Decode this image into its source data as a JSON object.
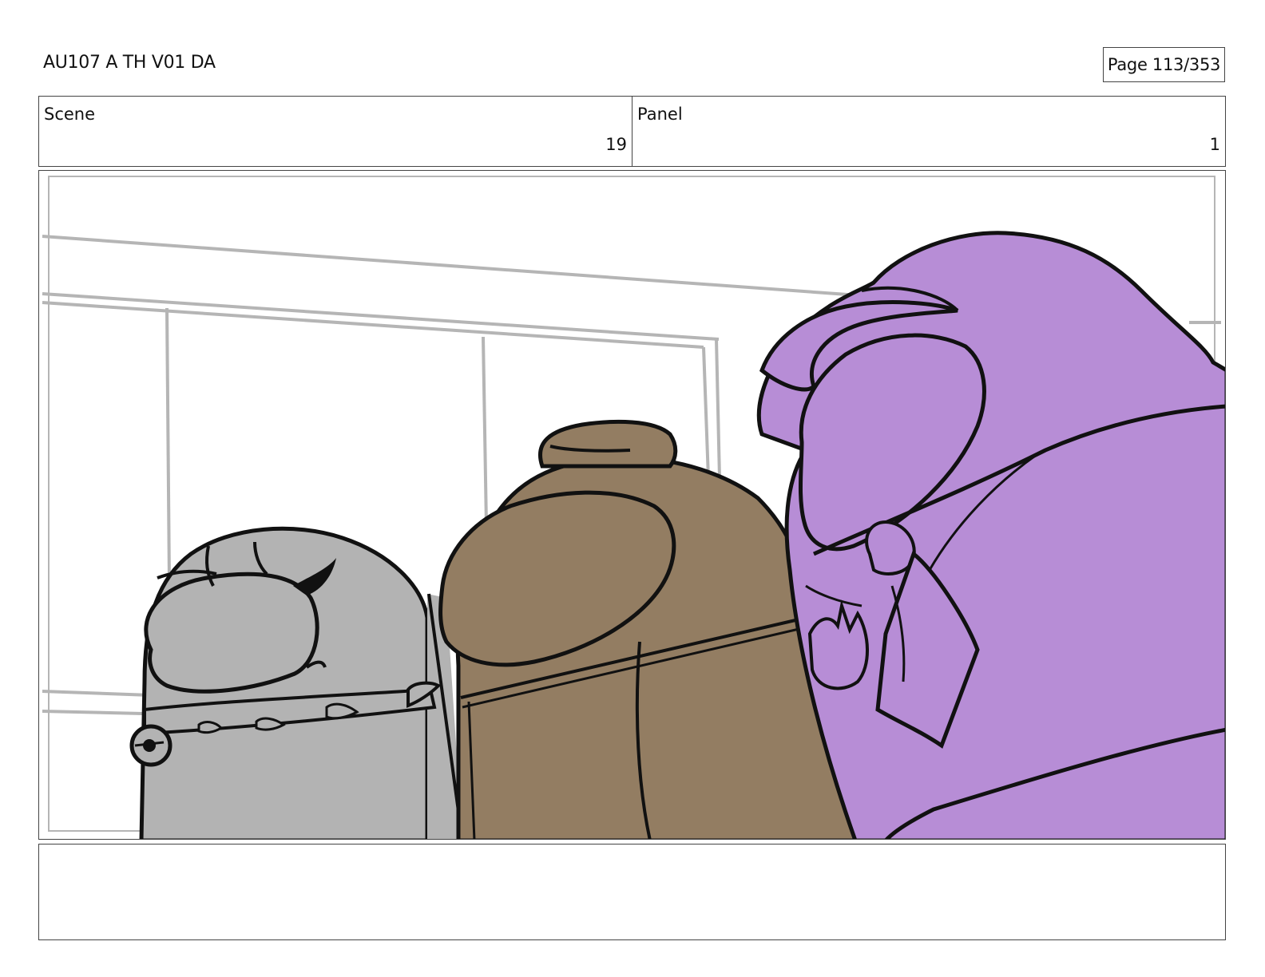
{
  "header": {
    "project_title": "AU107 A TH V01 DA",
    "page_label": "Page 113/353"
  },
  "info": {
    "scene_label": "Scene",
    "scene_value": "19",
    "panel_label": "Panel",
    "panel_value": "1"
  },
  "colors": {
    "gray_character": "#b3b3b3",
    "brown_character": "#937d62",
    "purple_character": "#b78dd6",
    "background_lines": "#b5b5b5",
    "ink": "#111111"
  }
}
